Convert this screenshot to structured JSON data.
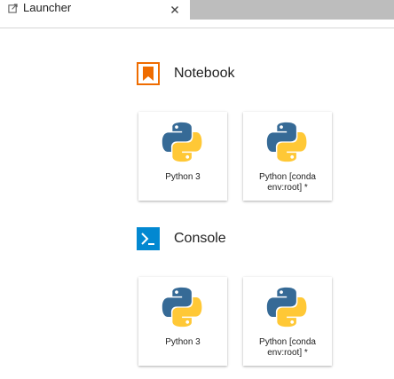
{
  "tab": {
    "label": "Launcher",
    "close_glyph": "×",
    "icon": "launch-icon"
  },
  "sections": {
    "notebook": {
      "title": "Notebook",
      "icon": "notebook-icon",
      "color": "#ef6c00",
      "kernels": [
        {
          "label": "Python 3",
          "icon": "python-logo-icon"
        },
        {
          "label": "Python [conda env:root] *",
          "icon": "python-logo-icon"
        }
      ]
    },
    "console": {
      "title": "Console",
      "icon": "console-icon",
      "color": "#0288d1",
      "kernels": [
        {
          "label": "Python 3",
          "icon": "python-logo-icon"
        },
        {
          "label": "Python [conda env:root] *",
          "icon": "python-logo-icon"
        }
      ]
    }
  },
  "colors": {
    "python_blue": "#366a96",
    "python_yellow": "#ffc836",
    "tabbar_rest": "#bdbdbd"
  }
}
